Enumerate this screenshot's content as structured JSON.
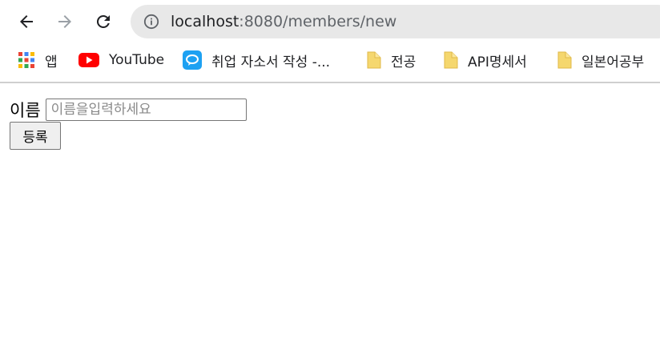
{
  "browser": {
    "url_host": "localhost",
    "url_path": ":8080/members/new",
    "back_icon": "arrow-left-icon",
    "forward_icon": "arrow-right-icon",
    "reload_icon": "reload-icon",
    "info_icon": "info-icon"
  },
  "bookmarks": [
    {
      "label": "앱",
      "icon": "apps-grid-icon"
    },
    {
      "label": "YouTube",
      "icon": "youtube-icon"
    },
    {
      "label": "취업 자소서 작성 -...",
      "icon": "chat-bubble-icon"
    },
    {
      "label": "전공",
      "icon": "folder-icon"
    },
    {
      "label": "API명세서",
      "icon": "folder-icon"
    },
    {
      "label": "일본어공부",
      "icon": "folder-icon"
    }
  ],
  "form": {
    "name_label": "이름",
    "name_value": "",
    "name_placeholder": "이름을입력하세요",
    "submit_label": "등록"
  },
  "colors": {
    "omnibox_bg": "#e8e8e8",
    "youtube_red": "#ff0000",
    "chat_blue": "#1da1f2",
    "folder_yellow": "#f5d76e"
  }
}
